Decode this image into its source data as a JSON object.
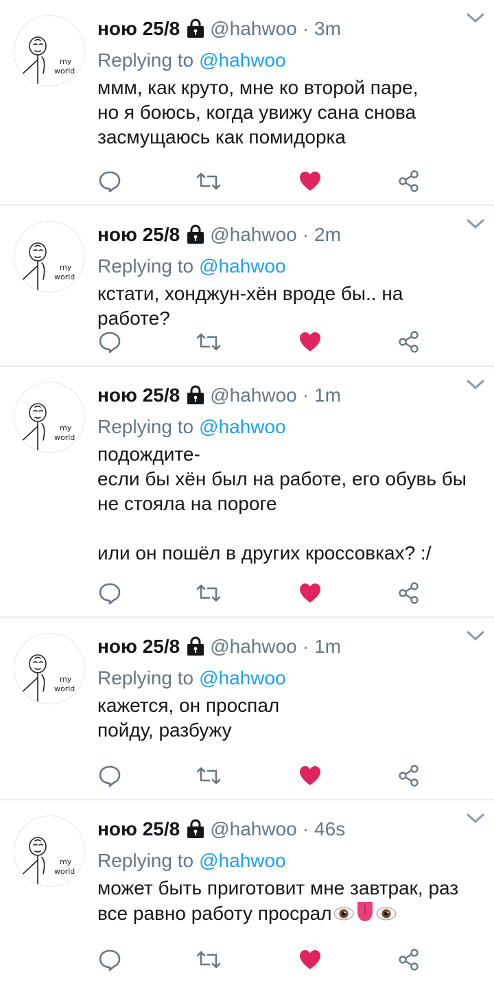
{
  "colors": {
    "link": "#1da1f2",
    "secondary": "#657786",
    "like_active": "#e0245e",
    "divider": "#e6ecf0"
  },
  "tweets": [
    {
      "display_name": "ною 25/8",
      "handle": "@hahwoo",
      "time": "3m",
      "replying_prefix": "Replying to",
      "replying_user": "@hahwoo",
      "text": "ммм, как круто, мне ко второй паре,\nно я боюсь, когда увижу сана снова\nзасмущаюсь как помидорка",
      "liked": true
    },
    {
      "display_name": "ною 25/8",
      "handle": "@hahwoo",
      "time": "2m",
      "replying_prefix": "Replying to",
      "replying_user": "@hahwoo",
      "text": "кстати, хонджун-хён вроде бы.. на работе?",
      "liked": true
    },
    {
      "display_name": "ною 25/8",
      "handle": "@hahwoo",
      "time": "1m",
      "replying_prefix": "Replying to",
      "replying_user": "@hahwoo",
      "text": "подождите-\nесли бы хён был на работе, его обувь бы\nне стояла на пороге\n\nили он пошёл в других кроссовках? :/",
      "liked": true
    },
    {
      "display_name": "ною 25/8",
      "handle": "@hahwoo",
      "time": "1m",
      "replying_prefix": "Replying to",
      "replying_user": "@hahwoo",
      "text": "кажется, он проспал\nпойду, разбужу",
      "liked": true
    },
    {
      "display_name": "ною 25/8",
      "handle": "@hahwoo",
      "time": "46s",
      "replying_prefix": "Replying to",
      "replying_user": "@hahwoo",
      "text": "может быть приготовит мне завтрак, раз\nвсе равно работу просрал",
      "trailing_emoji": [
        "eye-emoji",
        "tongue-emoji",
        "eye-emoji"
      ],
      "liked": true
    }
  ],
  "avatar": {
    "text_line1": "my",
    "text_line2": "world"
  },
  "icons": {
    "lock": "lock-icon",
    "chevron": "chevron-down-icon",
    "reply": "reply-icon",
    "retweet": "retweet-icon",
    "like": "heart-icon",
    "share": "share-icon"
  }
}
